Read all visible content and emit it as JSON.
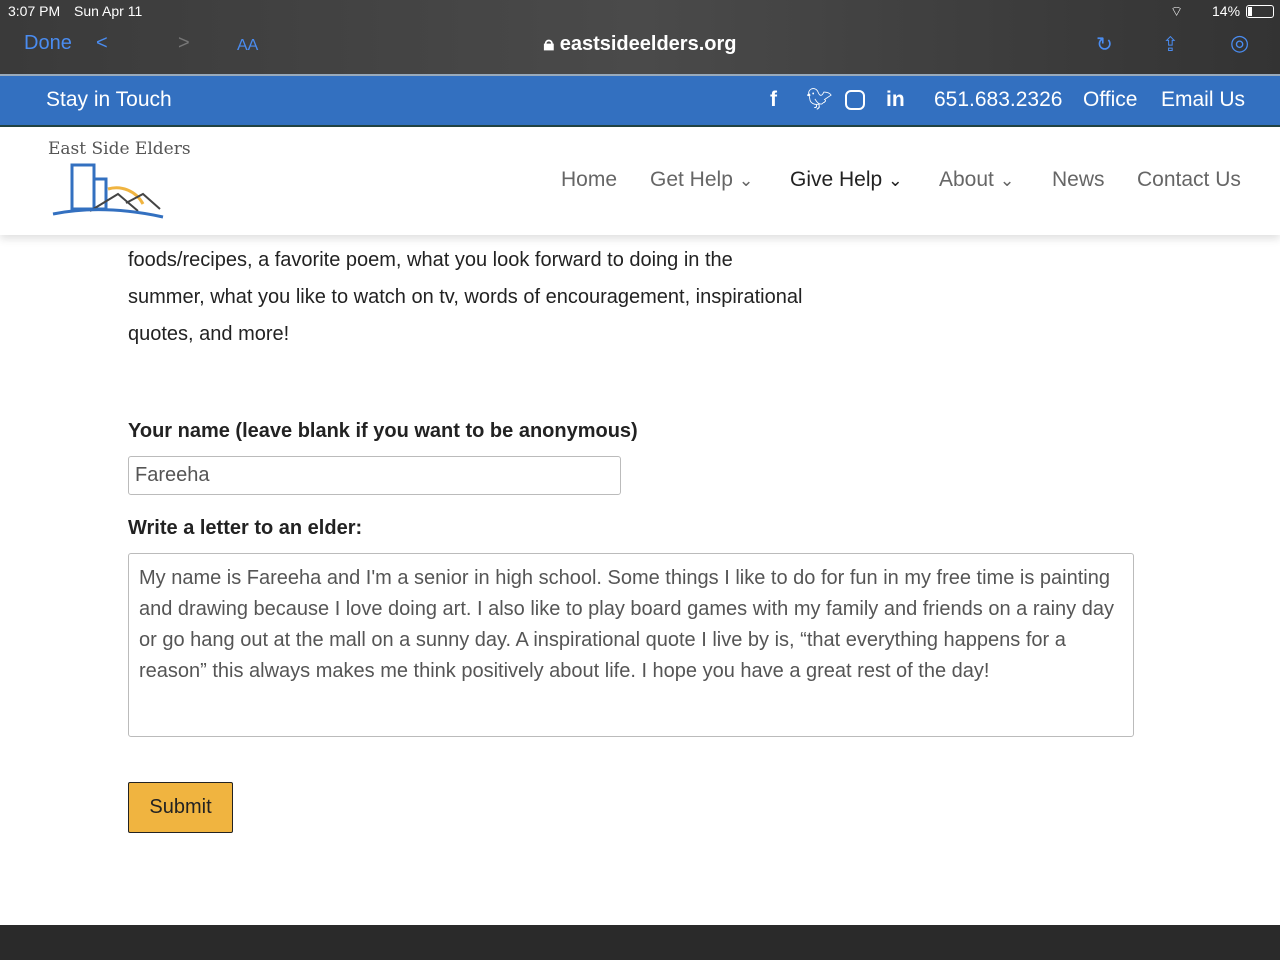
{
  "status": {
    "time": "3:07 PM",
    "date": "Sun Apr 11",
    "battery": "14%"
  },
  "browser": {
    "done": "Done",
    "text_size": "AA",
    "url": "eastsideelders.org"
  },
  "topbar": {
    "title": "Stay in Touch",
    "phone": "651.683.2326",
    "office": "Office",
    "email": "Email Us"
  },
  "logo": {
    "text": "East Side Elders"
  },
  "nav": [
    {
      "label": "Home"
    },
    {
      "label": "Get Help"
    },
    {
      "label": "Give Help"
    },
    {
      "label": "About"
    },
    {
      "label": "News"
    },
    {
      "label": "Contact Us"
    }
  ],
  "intro": "foods/recipes, a favorite poem, what you look forward to doing in the summer, what you like to watch on tv, words of encouragement, inspirational quotes, and more!",
  "form": {
    "name_label": "Your name (leave blank if you want to be anonymous)",
    "name_value": "Fareeha",
    "letter_label": "Write a letter to an elder:",
    "letter_value": "My name is Fareeha and I'm a senior in high school. Some things I like to do for fun in my free time is painting and drawing because I love doing art. I also like to play board games with my family and friends on a rainy day or go hang out at the mall on a sunny day. A inspirational quote I live by is, “that everything happens for a reason” this always makes me think positively about life. I hope you have a great rest of the day!",
    "submit": "Submit"
  },
  "colors": {
    "brand": "#3370c0",
    "submit": "#f0b440"
  }
}
